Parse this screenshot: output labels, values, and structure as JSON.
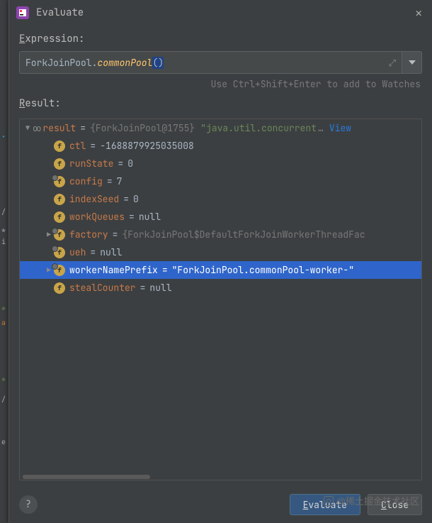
{
  "title": "Evaluate",
  "expression": {
    "label_prefix": "E",
    "label_rest": "xpression:",
    "class": "ForkJoinPool.",
    "method": "commonPool",
    "parens": "()"
  },
  "hint": "Use Ctrl+Shift+Enter to add to Watches",
  "result_label_prefix": "R",
  "result_label_rest": "esult:",
  "root": {
    "name": "result",
    "typeRef": "{ForkJoinPool@1755}",
    "valuePrefix": "\"java.util.concurrent",
    "ellipsis": "…",
    "view": "View"
  },
  "fields": [
    {
      "name": "ctl",
      "value": "-1688879925035008",
      "final": false,
      "str": false,
      "arrow": false
    },
    {
      "name": "runState",
      "value": "0",
      "final": false,
      "str": false,
      "arrow": false
    },
    {
      "name": "config",
      "value": "7",
      "final": true,
      "str": false,
      "arrow": false
    },
    {
      "name": "indexSeed",
      "value": "0",
      "final": false,
      "str": false,
      "arrow": false
    },
    {
      "name": "workQueues",
      "value": "null",
      "final": false,
      "str": false,
      "arrow": false
    },
    {
      "name": "factory",
      "value": "{ForkJoinPool$DefaultForkJoinWorkerThreadFac",
      "final": true,
      "str": false,
      "gray": true,
      "arrow": true
    },
    {
      "name": "ueh",
      "value": "null",
      "final": true,
      "str": false,
      "arrow": false
    },
    {
      "name": "workerNamePrefix",
      "value": "\"ForkJoinPool.commonPool-worker-\"",
      "final": true,
      "str": true,
      "arrow": true,
      "selected": true
    },
    {
      "name": "stealCounter",
      "value": "null",
      "final": false,
      "str": false,
      "arrow": false
    }
  ],
  "buttons": {
    "evaluate": "Evaluate",
    "close": "Close",
    "close_ul": "C"
  },
  "watermark": "稀土掘金技术社区"
}
